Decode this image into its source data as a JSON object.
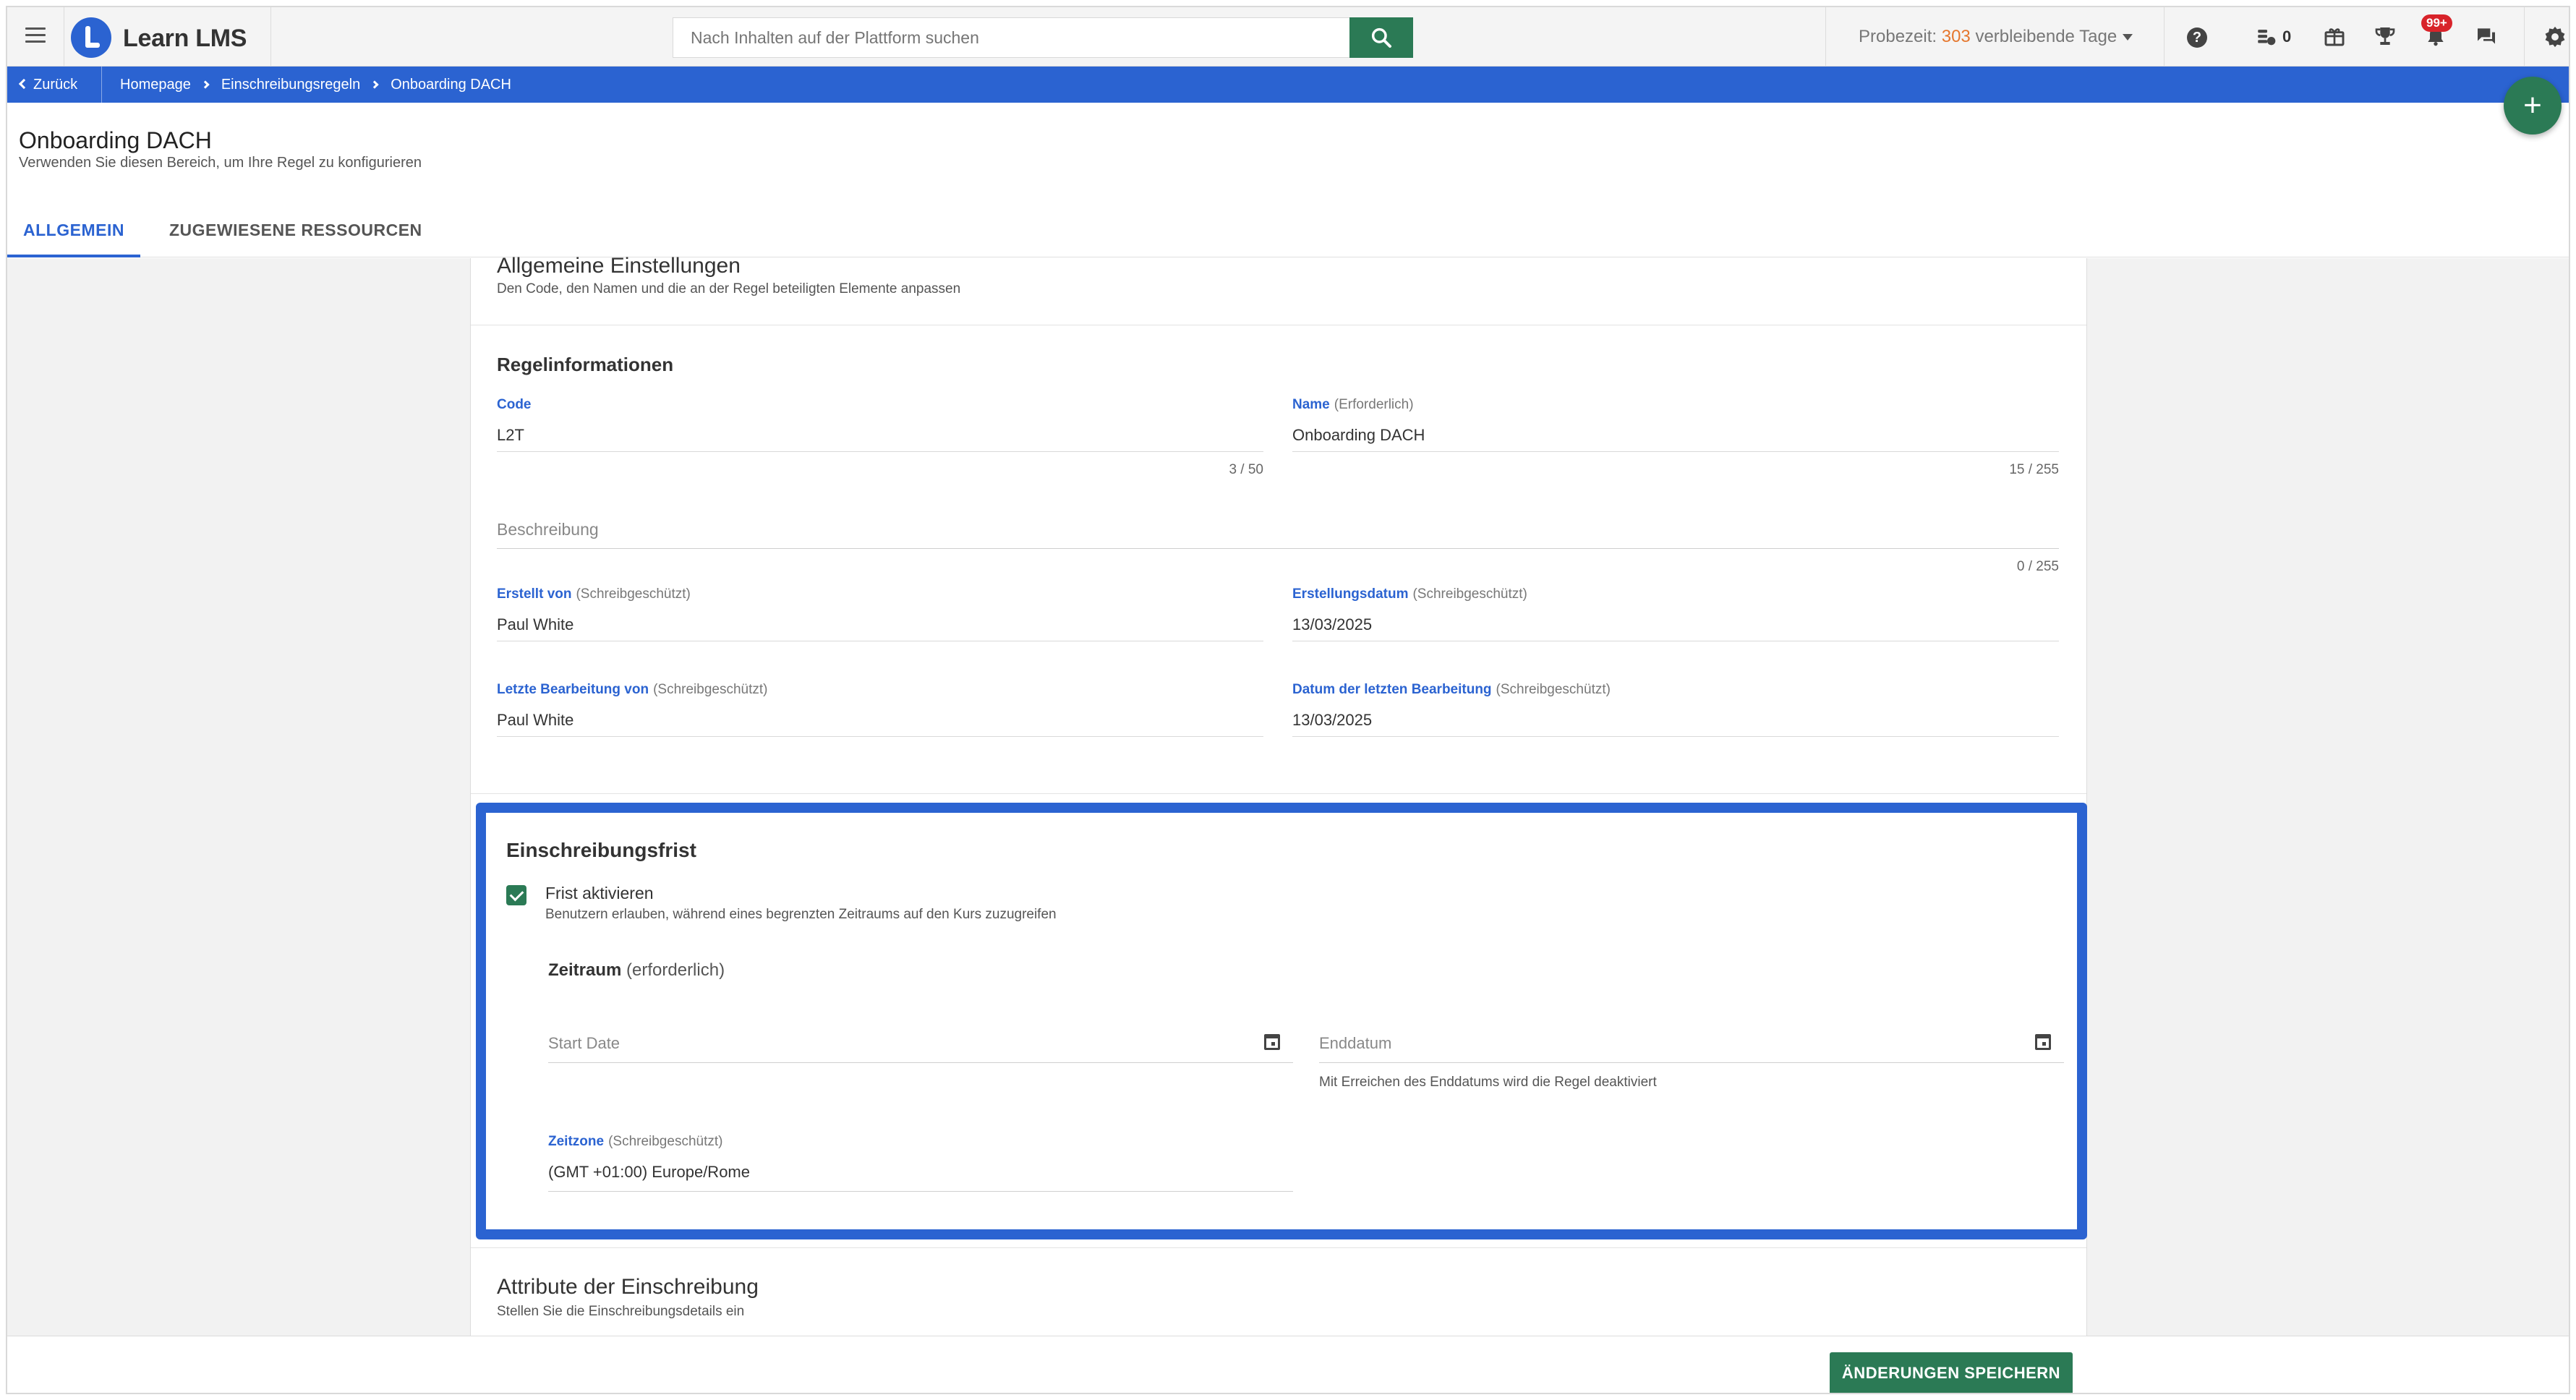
{
  "app": {
    "brand": "Learn LMS",
    "search_placeholder": "Nach Inhalten auf der Plattform suchen",
    "trial": {
      "prefix": "Probezeit: ",
      "days": "303",
      "suffix": " verbleibende Tage"
    },
    "coins": "0",
    "notifications_badge": "99+",
    "icons": [
      "menu-icon",
      "search-icon",
      "help-icon",
      "coins-icon",
      "gift-icon",
      "trophy-icon",
      "bell-icon",
      "chat-icon",
      "gear-icon"
    ]
  },
  "breadcrumb": {
    "back": "Zurück",
    "items": [
      "Homepage",
      "Einschreibungsregeln",
      "Onboarding DACH"
    ]
  },
  "page": {
    "title": "Onboarding DACH",
    "subtitle": "Verwenden Sie diesen Bereich, um Ihre Regel zu konfigurieren",
    "tabs": [
      "ALLGEMEIN",
      "ZUGEWIESENE RESSOURCEN"
    ]
  },
  "general": {
    "title": "Allgemeine Einstellungen",
    "subtitle": "Den Code, den Namen und die an der Regel beteiligten Elemente anpassen"
  },
  "rule_info": {
    "title": "Regelinformationen",
    "code": {
      "label": "Code",
      "value": "L2T",
      "counter": "3 / 50"
    },
    "name": {
      "label": "Name",
      "note": "(Erforderlich)",
      "value": "Onboarding DACH",
      "counter": "15 / 255"
    },
    "description": {
      "placeholder": "Beschreibung",
      "counter": "0 / 255"
    },
    "created_by": {
      "label": "Erstellt von",
      "note": "(Schreibgeschützt)",
      "value": "Paul White"
    },
    "created_on": {
      "label": "Erstellungsdatum",
      "note": "(Schreibgeschützt)",
      "value": "13/03/2025"
    },
    "last_edit_by": {
      "label": "Letzte Bearbeitung von",
      "note": "(Schreibgeschützt)",
      "value": "Paul White"
    },
    "last_edit_on": {
      "label": "Datum der letzten Bearbeitung",
      "note": "(Schreibgeschützt)",
      "value": "13/03/2025"
    }
  },
  "deadline": {
    "title": "Einschreibungsfrist",
    "checkbox_label": "Frist aktivieren",
    "checkbox_help": "Benutzern erlauben, während eines begrenzten Zeitraums auf den Kurs zuzugreifen",
    "checked": true,
    "period_label": "Zeitraum",
    "period_note": "(erforderlich)",
    "start_placeholder": "Start Date",
    "end_placeholder": "Enddatum",
    "end_help": "Mit Erreichen des Enddatums wird die Regel deaktiviert",
    "timezone": {
      "label": "Zeitzone",
      "note": "(Schreibgeschützt)",
      "value": "(GMT +01:00) Europe/Rome"
    }
  },
  "attributes": {
    "title": "Attribute der Einschreibung",
    "subtitle": "Stellen Sie die Einschreibungsdetails ein"
  },
  "footer": {
    "save": "ÄNDERUNGEN SPEICHERN"
  },
  "colors": {
    "primary_blue": "#2b63d1",
    "accent_green": "#2b7a55",
    "trial_orange": "#e5772e",
    "badge_red": "#d8232a"
  }
}
